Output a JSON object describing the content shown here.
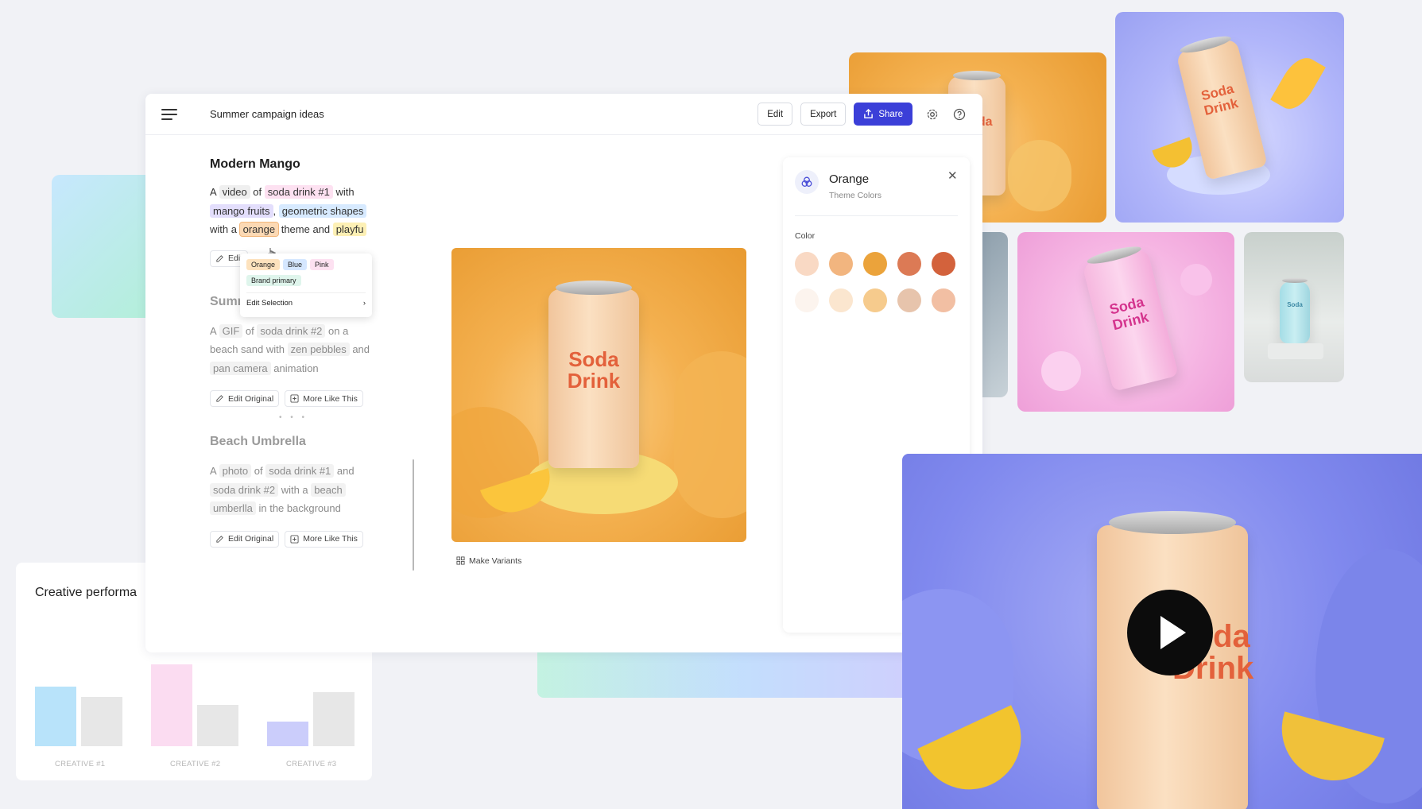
{
  "app": {
    "title": "Summer campaign ideas",
    "edit_label": "Edit",
    "export_label": "Export",
    "share_label": "Share"
  },
  "sections": {
    "modern_mango": {
      "title": "Modern Mango",
      "text": {
        "a": "A",
        "video": "video",
        "of": "of",
        "soda1": "soda drink #1",
        "with1": "with",
        "mango": "mango fruits",
        "comma": ",",
        "geo": "geometric shapes",
        "with2": "with a",
        "orange": "orange",
        "theme": "theme and",
        "playful": "playfu"
      },
      "edit_btn": "Edit"
    },
    "summer_zen": {
      "title": "Summer Zen",
      "text": {
        "a": "A",
        "gif": "GIF",
        "of": "of",
        "soda2": "soda drink #2",
        "ona": "on a",
        "beach": "beach sand with",
        "zen": "zen pebbles",
        "and": "and",
        "pan": "pan camera",
        "anim": "animation"
      },
      "edit_original": "Edit Original",
      "more_like": "More Like This"
    },
    "beach_umbrella": {
      "title": "Beach Umbrella",
      "text": {
        "a": "A",
        "photo": "photo",
        "of": "of",
        "soda1": "soda drink #1",
        "and": "and",
        "soda2": "soda drink #2",
        "witha": "with a",
        "beach": "beach",
        "umbrella": "umberlla",
        "bg": "in the background"
      },
      "edit_original": "Edit Original",
      "more_like": "More Like This"
    }
  },
  "popup": {
    "tags": [
      "Orange",
      "Blue",
      "Pink"
    ],
    "brand": "Brand primary",
    "edit_selection": "Edit Selection"
  },
  "make_variants": "Make Variants",
  "right_panel": {
    "title": "Orange",
    "subtitle": "Theme Colors",
    "color_label": "Color",
    "row1": [
      "#f9d9c4",
      "#f2b57f",
      "#eba33b",
      "#dc7a55",
      "#d3623c"
    ],
    "row2": [
      "#fcf4ee",
      "#fbe6cf",
      "#f6cb8d",
      "#e7c4ac",
      "#f2bfa3"
    ]
  },
  "can_text": {
    "line1": "Soda",
    "line2": "Drink"
  },
  "performance": {
    "title": "Creative performa",
    "labels": [
      "CREATIVE #1",
      "CREATIVE #2",
      "CREATIVE #3"
    ],
    "chart_data": {
      "type": "bar",
      "categories": [
        "CREATIVE #1",
        "CREATIVE #2",
        "CREATIVE #3"
      ],
      "series": [
        {
          "values": [
            80,
            110,
            33
          ]
        },
        {
          "values": [
            66,
            56,
            73
          ]
        }
      ],
      "colors": [
        [
          "#b8e3fa",
          "#e7e7e7"
        ],
        [
          "#fbdcf1",
          "#e7e7e7"
        ],
        [
          "#cbcdfb",
          "#e7e7e7"
        ]
      ]
    }
  }
}
